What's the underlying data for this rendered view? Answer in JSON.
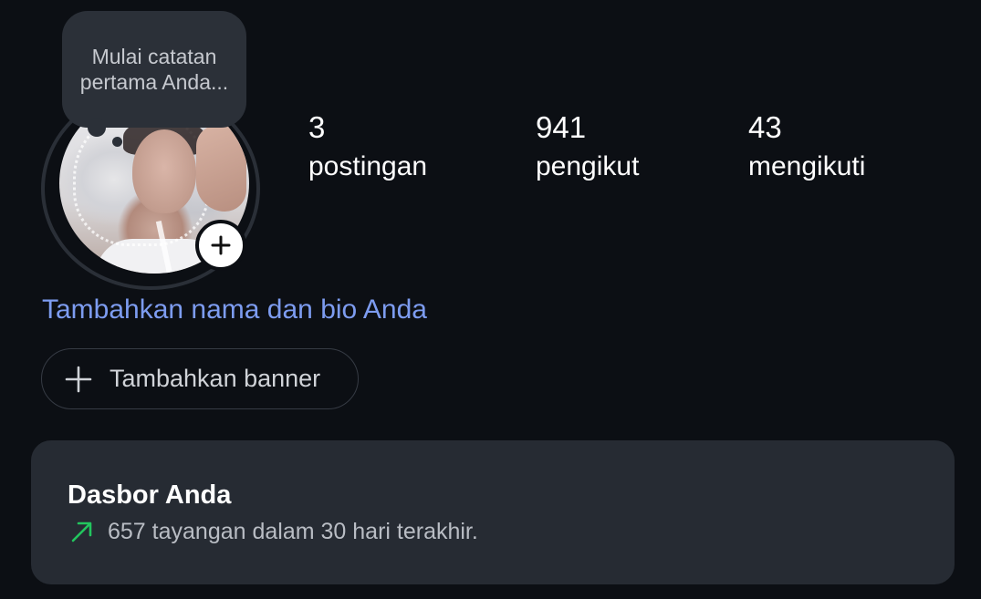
{
  "note": {
    "placeholder": "Mulai catatan pertama Anda..."
  },
  "stats": [
    {
      "value": "3",
      "label": "postingan"
    },
    {
      "value": "941",
      "label": "pengikut"
    },
    {
      "value": "43",
      "label": "mengikuti"
    }
  ],
  "bio": {
    "link_label": "Tambahkan nama dan bio Anda"
  },
  "banner": {
    "label": "Tambahkan banner"
  },
  "dashboard": {
    "title": "Dasbor Anda",
    "subtitle": "657 tayangan dalam 30 hari terakhir."
  },
  "colors": {
    "background": "#0c0f14",
    "card": "#262b33",
    "link": "#7d9cf0",
    "trend": "#22c55e"
  },
  "icons": {
    "add_story": "plus-icon",
    "banner": "plus-icon",
    "trend": "trend-up-arrow-icon"
  }
}
